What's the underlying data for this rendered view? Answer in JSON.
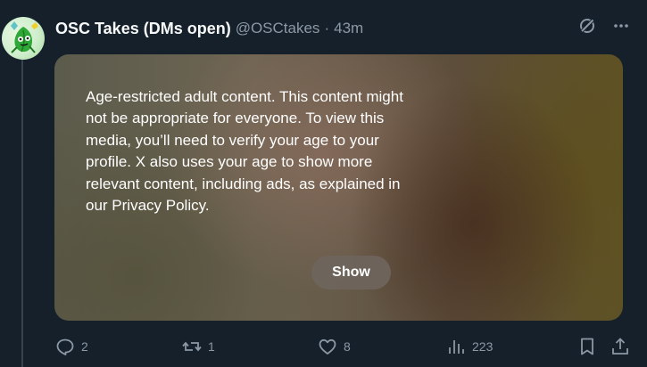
{
  "post": {
    "display_name": "OSC Takes (DMs open)",
    "handle": "@OSCtakes",
    "separator": "·",
    "time": "43m",
    "media": {
      "warning_text": "Age-restricted adult content. This content might not be appropriate for everyone. To view this media, you’ll need to verify your age to your profile. X also uses your age to show more relevant content, including ads, as explained in our Privacy Policy.",
      "show_label": "Show"
    },
    "actions": {
      "replies": "2",
      "reposts": "1",
      "likes": "8",
      "views": "223"
    }
  },
  "icons": {
    "avatar": "leaf-character-avatar",
    "top_right": [
      "grok-icon",
      "more-icon"
    ],
    "actions": [
      "reply-icon",
      "repost-icon",
      "like-icon",
      "views-icon",
      "bookmark-icon",
      "share-icon"
    ]
  },
  "colors": {
    "background": "#15202b",
    "primary_text": "#f7f9f9",
    "secondary_text": "#8b98a5",
    "thread_line": "#38444d"
  }
}
